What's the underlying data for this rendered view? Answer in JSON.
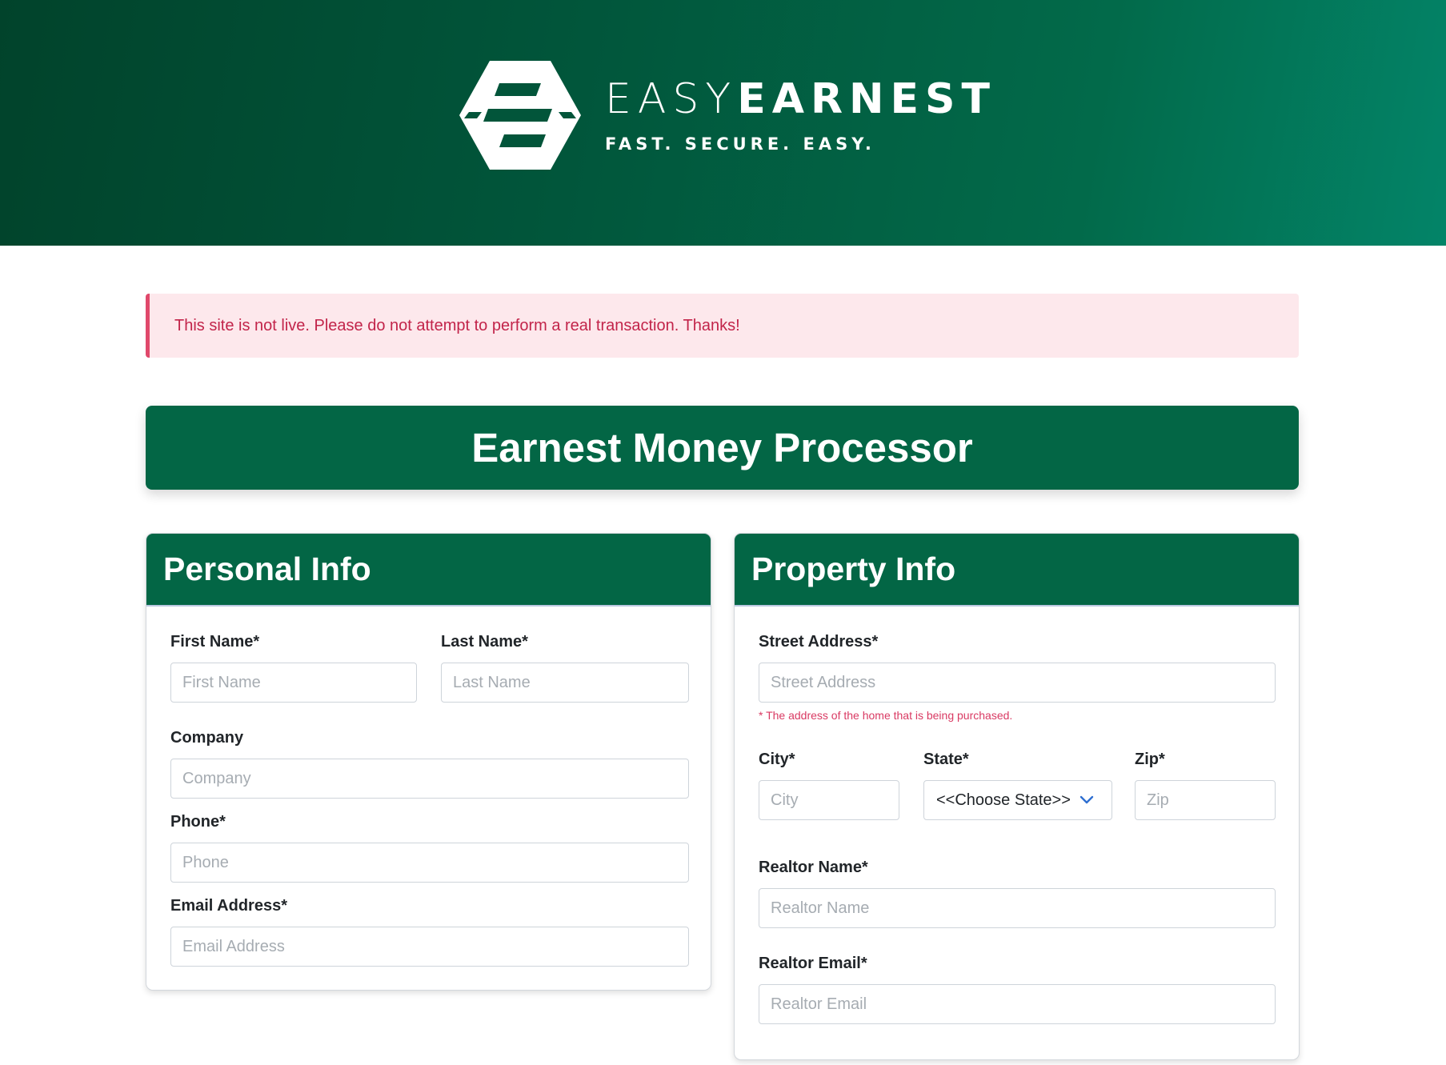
{
  "brand": {
    "name_light": "EASY",
    "name_bold": "EARNEST",
    "tagline": "FAST. SECURE. EASY.",
    "logo_icon": "hexagon-e-logo-icon",
    "colors": {
      "header_dark": "#01432b",
      "header_light": "#038468",
      "primary": "#036645"
    }
  },
  "alert": {
    "text": "This site is not live. Please do not attempt to perform a real transaction. Thanks!",
    "colors": {
      "background": "#fde8ec",
      "border": "#e0486b",
      "text": "#c2244a"
    }
  },
  "page_title": "Earnest Money Processor",
  "personal": {
    "heading": "Personal Info",
    "first_name": {
      "label": "First Name*",
      "placeholder": "First Name"
    },
    "last_name": {
      "label": "Last Name*",
      "placeholder": "Last Name"
    },
    "company": {
      "label": "Company",
      "placeholder": "Company"
    },
    "phone": {
      "label": "Phone*",
      "placeholder": "Phone"
    },
    "email": {
      "label": "Email Address*",
      "placeholder": "Email Address"
    }
  },
  "property": {
    "heading": "Property Info",
    "street": {
      "label": "Street Address*",
      "placeholder": "Street Address",
      "hint": "* The address of the home that is being purchased."
    },
    "city": {
      "label": "City*",
      "placeholder": "City"
    },
    "state": {
      "label": "State*",
      "selected": "<<Choose State>>",
      "icon": "chevron-down-icon"
    },
    "zip": {
      "label": "Zip*",
      "placeholder": "Zip"
    },
    "realtor_name": {
      "label": "Realtor Name*",
      "placeholder": "Realtor Name"
    },
    "realtor_email": {
      "label": "Realtor Email*",
      "placeholder": "Realtor Email"
    }
  }
}
